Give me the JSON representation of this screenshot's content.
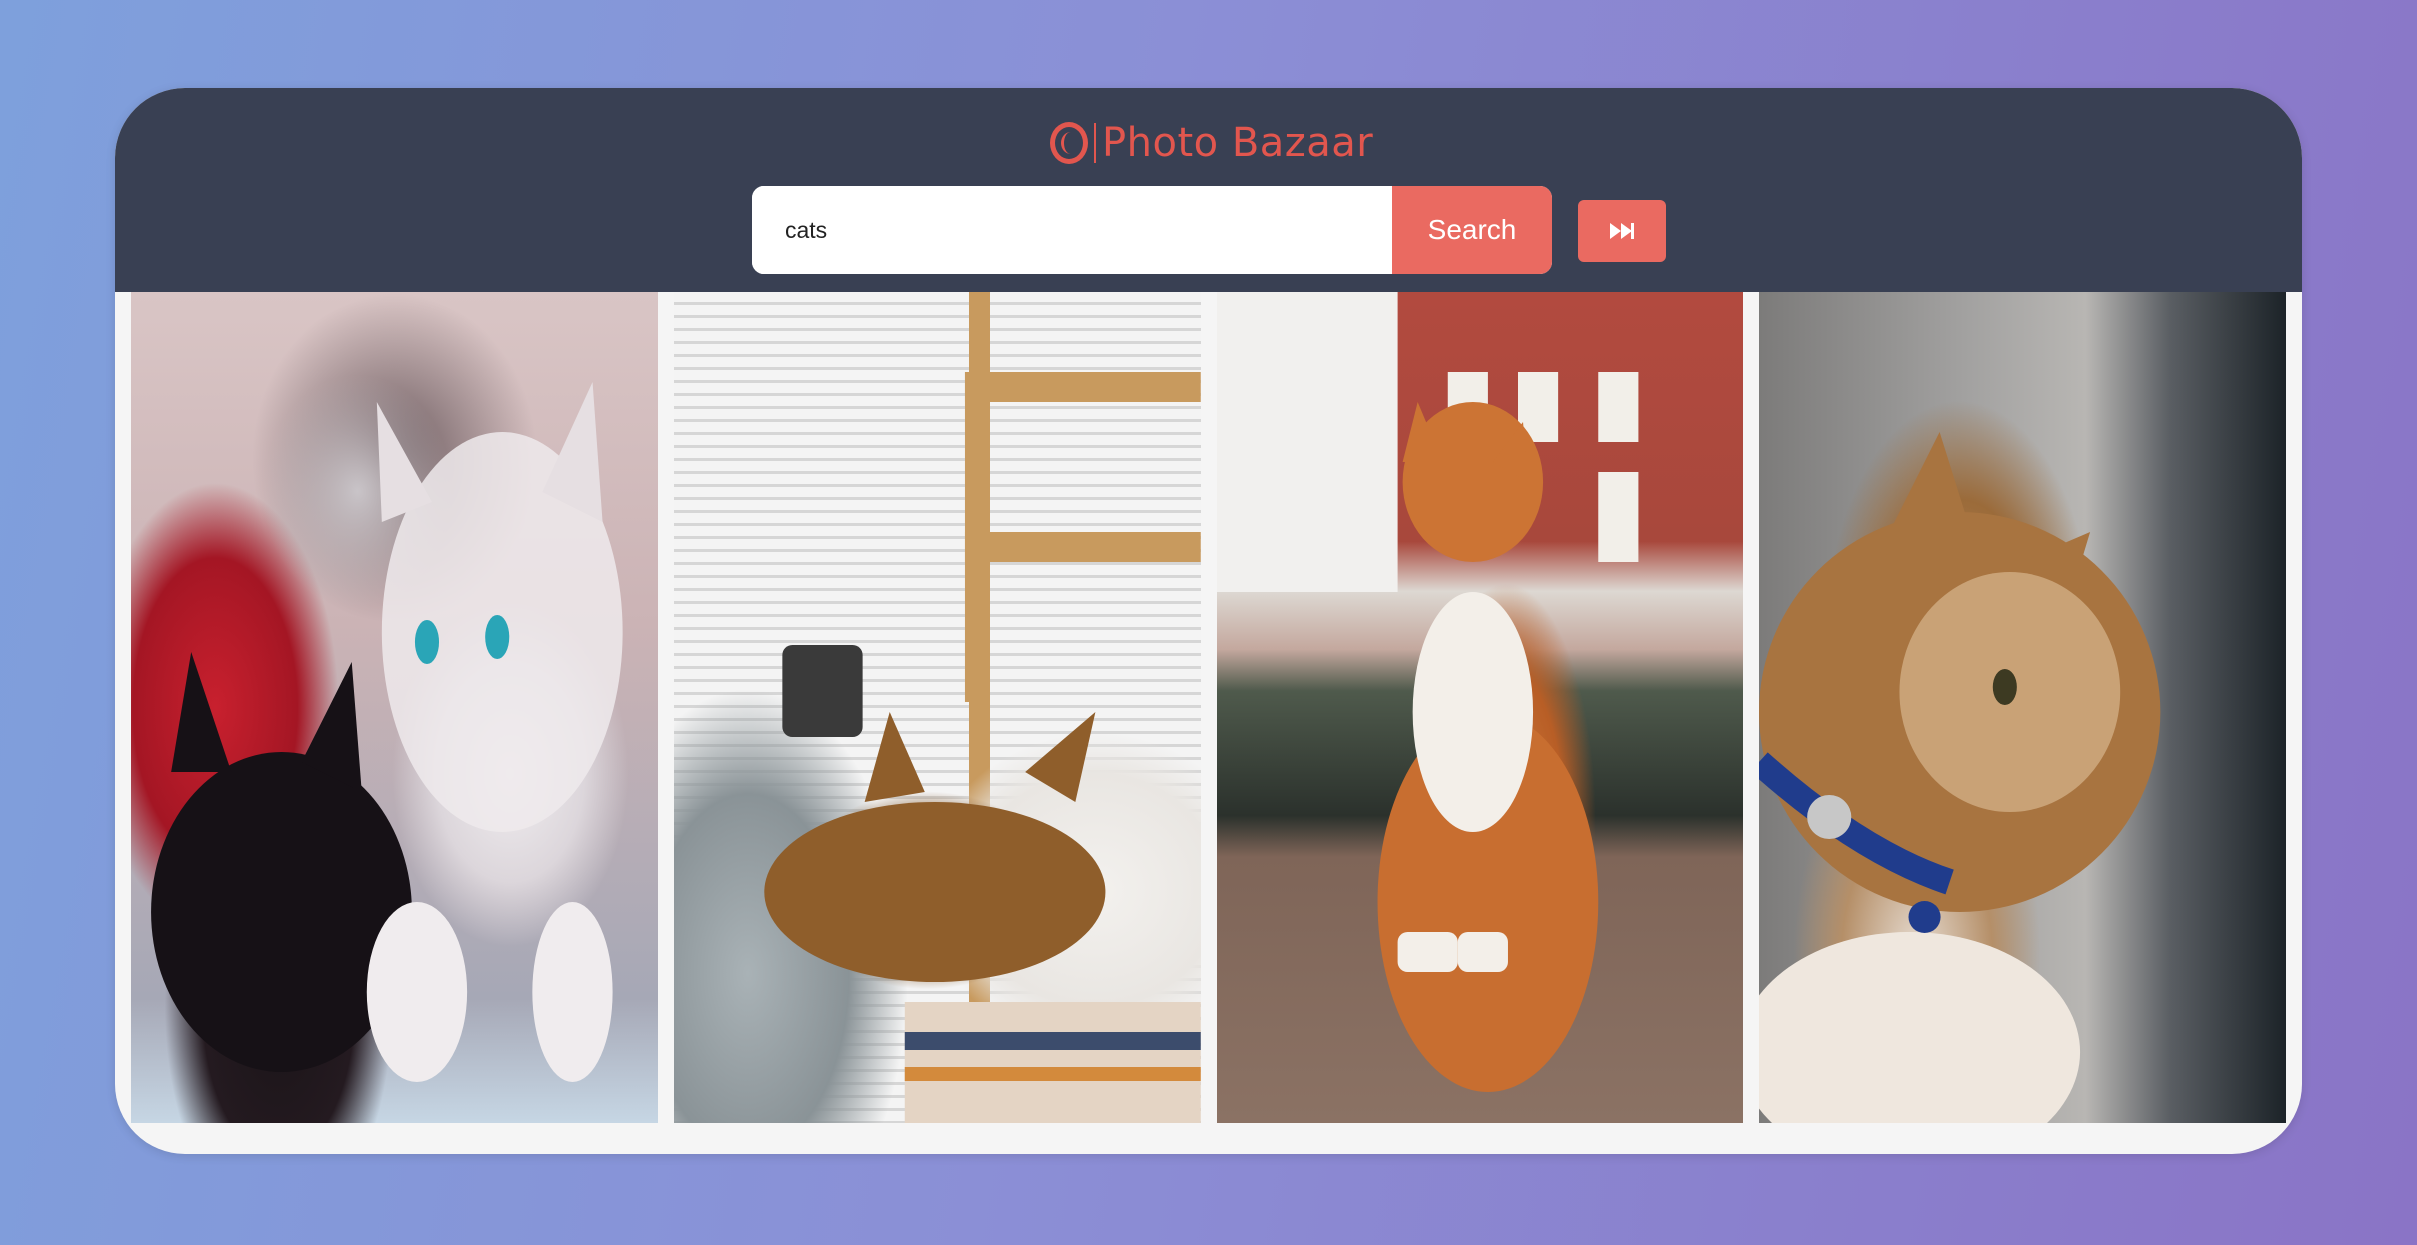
{
  "app": {
    "title": "Photo Bazaar",
    "brand_color": "#e2564e",
    "logo_icon": "bazaar-logo-icon"
  },
  "search": {
    "value": "cats",
    "placeholder": "",
    "button_label": "Search",
    "accent_color": "#ea6a61"
  },
  "controls": {
    "next_icon": "fast-forward-icon"
  },
  "gallery": {
    "photos": [
      {
        "subject": "kittens"
      },
      {
        "subject": "sleeping-tabby"
      },
      {
        "subject": "orange-cat-street"
      },
      {
        "subject": "cat-profile"
      }
    ]
  }
}
